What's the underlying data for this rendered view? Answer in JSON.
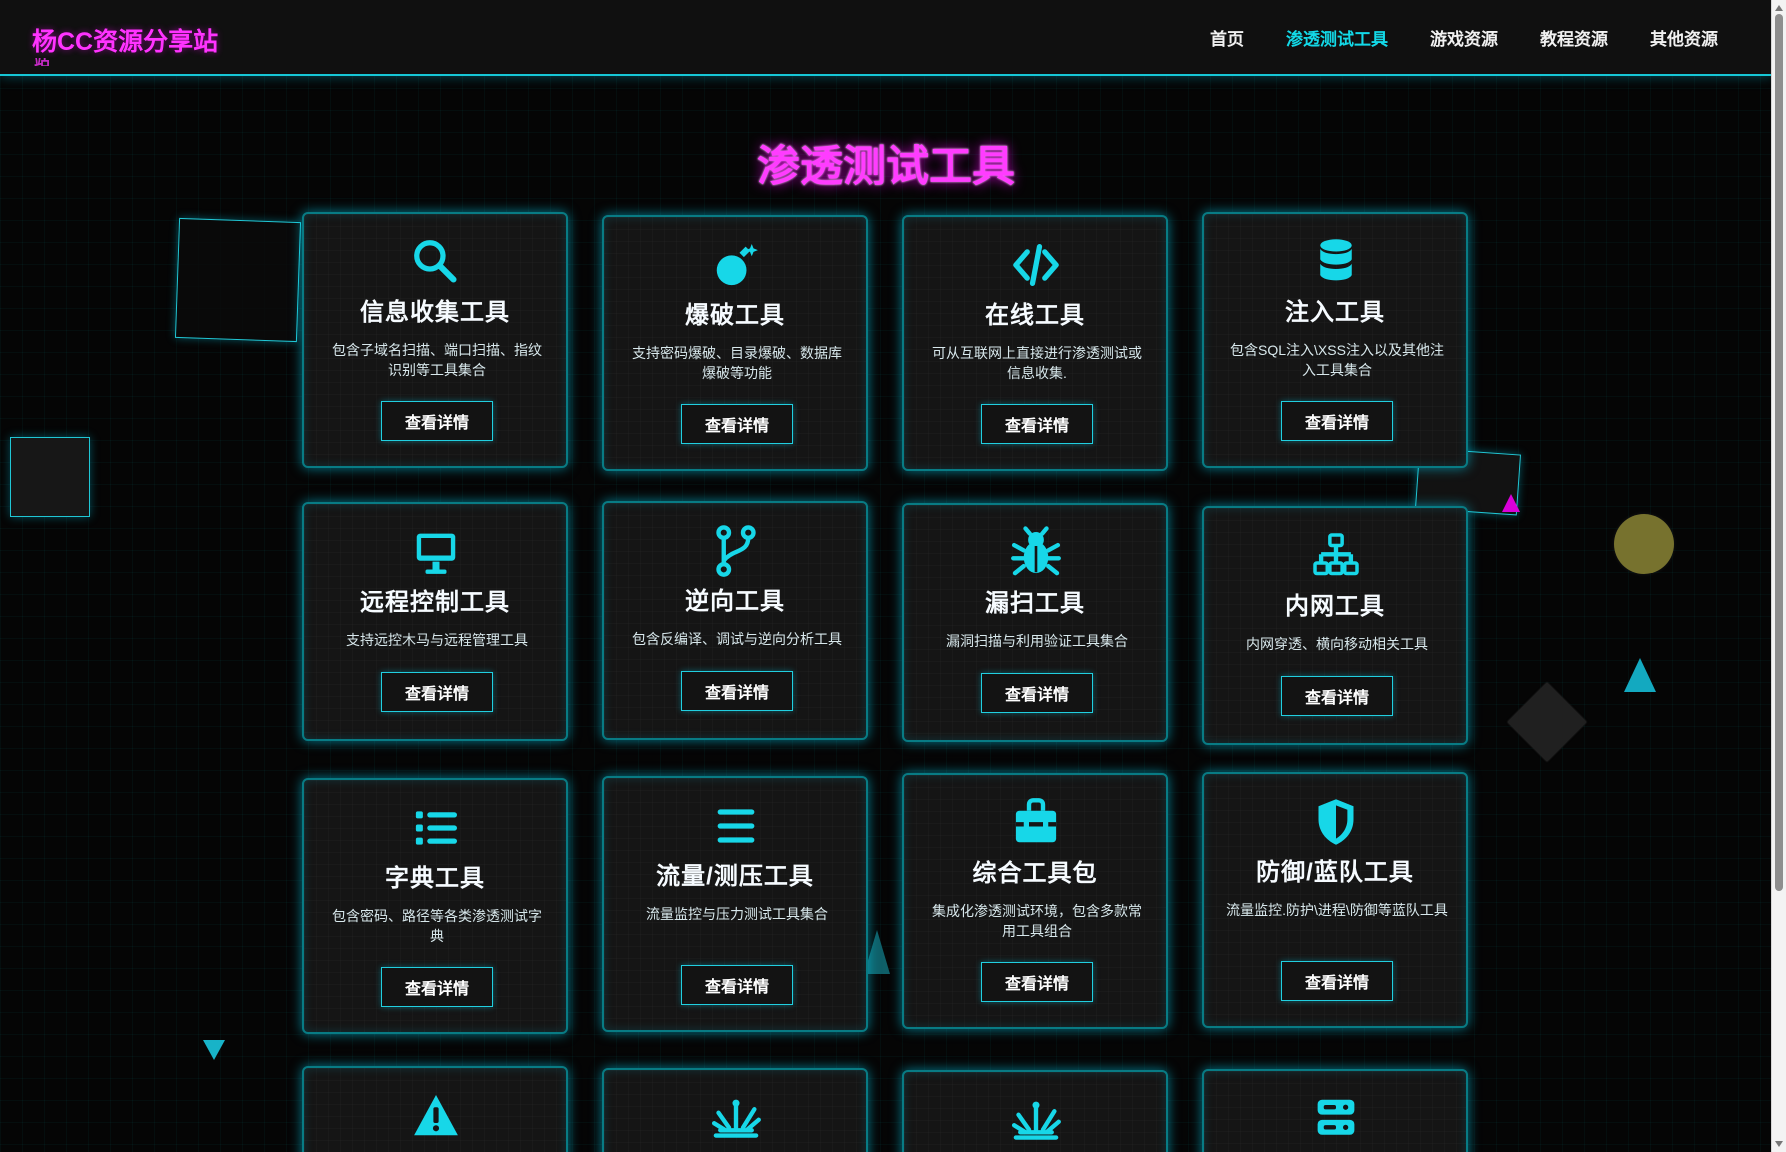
{
  "header": {
    "brand": "杨CC资源分享站",
    "brand_overlap": "站",
    "nav": [
      {
        "label": "首页",
        "active": false
      },
      {
        "label": "渗透测试工具",
        "active": true
      },
      {
        "label": "游戏资源",
        "active": false
      },
      {
        "label": "教程资源",
        "active": false
      },
      {
        "label": "其他资源",
        "active": false
      }
    ]
  },
  "main": {
    "title": "渗透测试工具",
    "button_label": "查看详情",
    "cards": [
      {
        "icon": "search-icon",
        "title": "信息收集工具",
        "description": "包含子域名扫描、端口扫描、指纹识别等工具集合"
      },
      {
        "icon": "bomb-icon",
        "title": "爆破工具",
        "description": "支持密码爆破、目录爆破、数据库爆破等功能"
      },
      {
        "icon": "code-icon",
        "title": "在线工具",
        "description": "可从互联网上直接进行渗透测试或信息收集."
      },
      {
        "icon": "database-icon",
        "title": "注入工具",
        "description": "包含SQL注入\\XSS注入以及其他注入工具集合"
      },
      {
        "icon": "monitor-icon",
        "title": "远程控制工具",
        "description": "支持远控木马与远程管理工具"
      },
      {
        "icon": "branch-icon",
        "title": "逆向工具",
        "description": "包含反编译、调试与逆向分析工具"
      },
      {
        "icon": "bug-icon",
        "title": "漏扫工具",
        "description": "漏洞扫描与利用验证工具集合"
      },
      {
        "icon": "network-icon",
        "title": "内网工具",
        "description": "内网穿透、横向移动相关工具"
      },
      {
        "icon": "list-icon",
        "title": "字典工具",
        "description": "包含密码、路径等各类渗透测试字典"
      },
      {
        "icon": "bars-icon",
        "title": "流量/测压工具",
        "description": "流量监控与压力测试工具集合"
      },
      {
        "icon": "toolbox-icon",
        "title": "综合工具包",
        "description": "集成化渗透测试环境，包含多款常用工具组合"
      },
      {
        "icon": "shield-icon",
        "title": "防御/蓝队工具",
        "description": "流量监控.防护\\进程\\防御等蓝队工具"
      },
      {
        "icon": "warning-icon",
        "title": "",
        "description": ""
      },
      {
        "icon": "burst-icon",
        "title": "",
        "description": ""
      },
      {
        "icon": "burst-icon",
        "title": "",
        "description": ""
      },
      {
        "icon": "server-icon",
        "title": "",
        "description": ""
      }
    ]
  },
  "colors": {
    "accent": "#13d9e8",
    "title": "#ff3cff",
    "background": "#050505"
  }
}
